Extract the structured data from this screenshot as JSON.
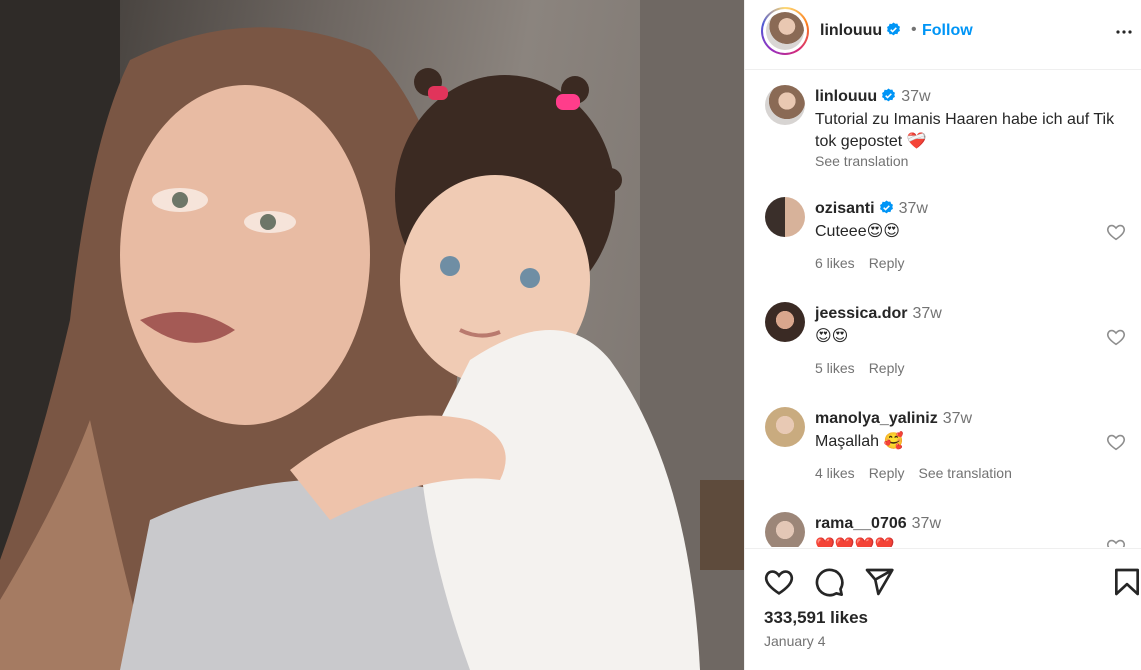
{
  "post": {
    "username": "linlouuu",
    "separator": "•",
    "follow_label": "Follow",
    "caption": "Tutorial zu Imanis Haaren habe ich auf Tik tok gepostet ❤️‍🩹",
    "caption_time": "37w",
    "see_translation": "See translation",
    "likes": "333,591 likes",
    "date": "January 4"
  },
  "comments": [
    {
      "username": "ozisanti",
      "verified": true,
      "time": "37w",
      "text": "Cuteee😍😍",
      "likes": "6 likes",
      "reply": "Reply",
      "translate": ""
    },
    {
      "username": "jeessica.dor",
      "verified": false,
      "time": "37w",
      "text": "😍😍",
      "likes": "5 likes",
      "reply": "Reply",
      "translate": ""
    },
    {
      "username": "manolya_yaliniz",
      "verified": false,
      "time": "37w",
      "text": "Maşallah 🥰",
      "likes": "4 likes",
      "reply": "Reply",
      "translate": "See translation"
    },
    {
      "username": "rama__0706",
      "verified": false,
      "time": "37w",
      "text": "❤️❤️❤️❤️",
      "likes": "",
      "reply": "",
      "translate": ""
    }
  ],
  "icons": {
    "more": "more-options-icon",
    "verified": "verified-badge-icon",
    "like": "heart-icon",
    "comment": "comment-bubble-icon",
    "share": "paper-plane-icon",
    "save": "bookmark-icon"
  },
  "colors": {
    "follow": "#0095f6",
    "verified": "#0095f6",
    "muted": "#737373",
    "text": "#262626"
  }
}
